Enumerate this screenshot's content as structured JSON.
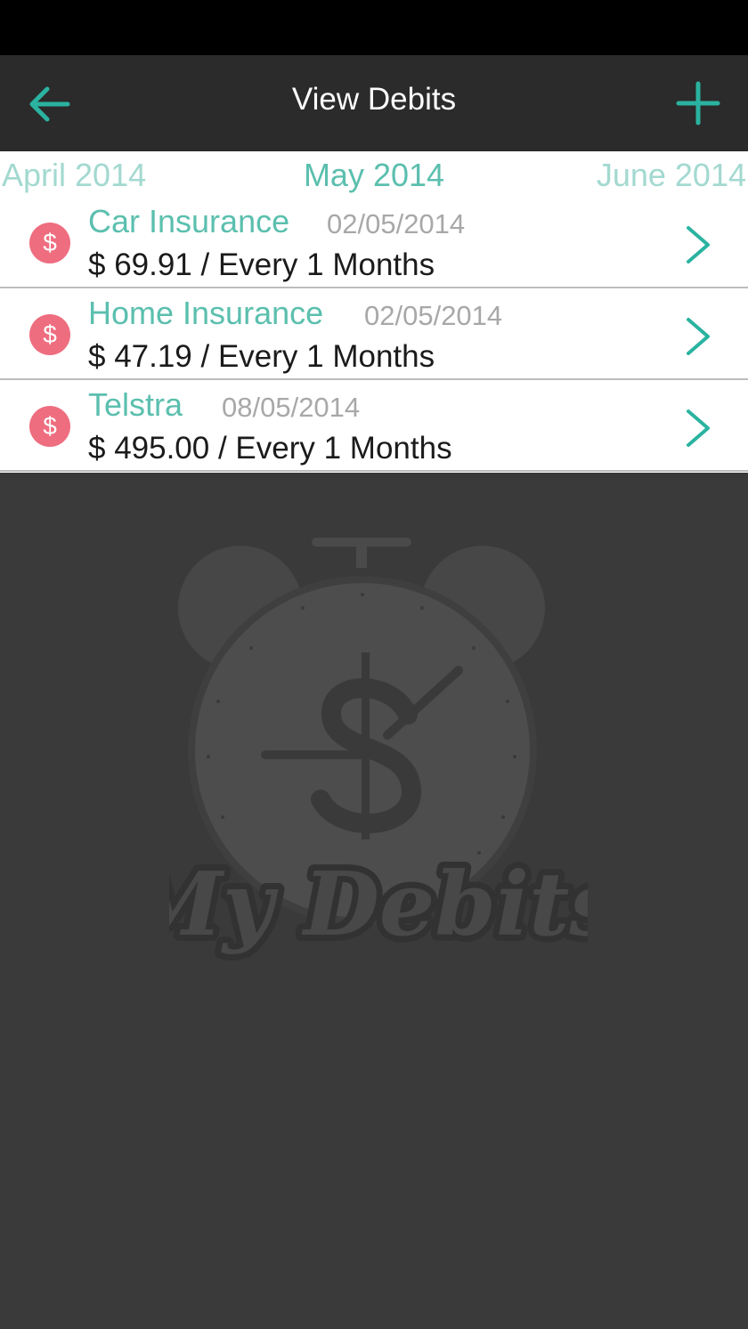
{
  "app_bar": {
    "title": "View Debits",
    "back_icon": "arrow-left-icon",
    "add_icon": "plus-icon"
  },
  "months": {
    "previous": "April 2014",
    "current": "May 2014",
    "next": "June 2014"
  },
  "debits": [
    {
      "name": "Car Insurance",
      "date": "02/05/2014",
      "amount": "$ 69.91 / Every 1 Months",
      "badge": "$"
    },
    {
      "name": "Home Insurance",
      "date": "02/05/2014",
      "amount": "$ 47.19 / Every 1 Months",
      "badge": "$"
    },
    {
      "name": "Telstra",
      "date": "08/05/2014",
      "amount": "$ 495.00 / Every 1 Months",
      "badge": "$"
    }
  ],
  "watermark": {
    "text": "My Debits"
  },
  "colors": {
    "accent": "#2ab3a0",
    "badge": "#ee6d7f",
    "name_text": "#5bbfae",
    "app_bar": "#2b2b2b",
    "background": "#3a3a3a"
  }
}
